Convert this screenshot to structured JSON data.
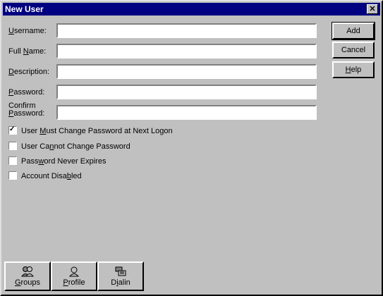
{
  "window": {
    "title": "New User",
    "close_label": "✕"
  },
  "fields": [
    {
      "id": "username",
      "label_pre": "",
      "label_hot": "U",
      "label_post": "sername:",
      "value": ""
    },
    {
      "id": "fullname",
      "label_pre": "Full ",
      "label_hot": "N",
      "label_post": "ame:",
      "value": ""
    },
    {
      "id": "description",
      "label_pre": "",
      "label_hot": "D",
      "label_post": "escription:",
      "value": ""
    },
    {
      "id": "password",
      "label_pre": "",
      "label_hot": "P",
      "label_post": "assword:",
      "value": ""
    },
    {
      "id": "confirm",
      "label_line1": "Confirm",
      "label_line2_hot": "P",
      "label_line2_rest": "assword:",
      "value": ""
    }
  ],
  "buttons": {
    "add": "Add",
    "cancel": "Cancel",
    "help_hot": "H",
    "help_rest": "elp"
  },
  "checkboxes": [
    {
      "pre": "User ",
      "hot": "M",
      "post": "ust Change Password at Next Logon",
      "checked": true
    },
    {
      "pre": "User Ca",
      "hot": "n",
      "post": "not Change Password",
      "checked": false
    },
    {
      "pre": "Pass",
      "hot": "w",
      "post": "ord Never Expires",
      "checked": false
    },
    {
      "pre": "Account Disa",
      "hot": "b",
      "post": "led",
      "checked": false
    }
  ],
  "bottom_buttons": [
    {
      "pre": "",
      "hot": "G",
      "post": "roups",
      "icon": "groups-icon"
    },
    {
      "pre": "",
      "hot": "P",
      "post": "rofile",
      "icon": "profile-icon"
    },
    {
      "pre": "D",
      "hot": "i",
      "post": "alin",
      "icon": "dialin-icon"
    }
  ]
}
